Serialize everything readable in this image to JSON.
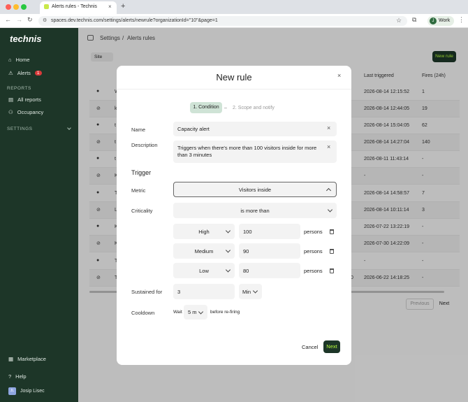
{
  "browser": {
    "tab_title": "Alerts rules - Technis",
    "url": "spaces.dev.technis.com/settings/alerts/newrule?organizationId=\"10\"&page=1",
    "profile_label": "Work",
    "profile_initial": "J"
  },
  "sidebar": {
    "logo": "technis",
    "home": "Home",
    "alerts": "Alerts",
    "alerts_badge": "1",
    "reports_header": "REPORTS",
    "all_reports": "All reports",
    "occupancy": "Occupancy",
    "settings_header": "SETTINGS",
    "marketplace": "Marketplace",
    "help": "Help",
    "user_name": "Josip Lisec",
    "user_initial": "JL"
  },
  "page": {
    "breadcrumb_settings": "Settings",
    "breadcrumb_sep": "/",
    "breadcrumb_current": "Alerts rules",
    "filter_site": "Site",
    "new_rule_button": "New rule",
    "columns": {
      "last_triggered": "Last triggered",
      "fires": "Fires (24h)"
    },
    "rows": [
      {
        "first": "W",
        "last": "2026-08-14 12:15:52",
        "fires": "1"
      },
      {
        "first": "k",
        "last": "2026-08-14 12:44:05",
        "fires": "19"
      },
      {
        "first": "t",
        "last": "2026-08-14 15:04:05",
        "fires": "62"
      },
      {
        "first": "t",
        "last": "2026-08-14 14:27:04",
        "fires": "140"
      },
      {
        "first": "t",
        "last": "2026-08-11 11:43:14",
        "fires": "-"
      },
      {
        "first": "K",
        "last": "-",
        "fires": "-"
      },
      {
        "first": "T",
        "last": "2026-08-14 14:58:57",
        "fires": "7"
      },
      {
        "first": "L",
        "last": "2026-08-14 10:11:14",
        "fires": "3"
      },
      {
        "first": "K",
        "last": "2026-07-22 13:22:19",
        "fires": "-"
      },
      {
        "first": "K",
        "last": "2026-07-30 14:22:09",
        "fires": "-"
      },
      {
        "first": "T",
        "last": "-",
        "fires": "-"
      },
      {
        "first": "T",
        "last": "2026-06-22 14:18:25",
        "fires": "-"
      }
    ],
    "row0_extra": "0",
    "previous": "Previous",
    "next": "Next"
  },
  "modal": {
    "title": "New rule",
    "step1": "1. Condition",
    "step_sep": "–",
    "step2": "2. Scope and notify",
    "name_label": "Name",
    "name_value": "Capacity alert",
    "description_label": "Description",
    "description_value": "Triggers when there's more than 100 visitors inside for more than 3 minutes",
    "trigger_heading": "Trigger",
    "metric_label": "Metric",
    "metric_value": "Visitors inside",
    "criticality_label": "Criticality",
    "operator_value": "is more than",
    "levels": [
      {
        "level": "High",
        "value": "100",
        "unit": "persons"
      },
      {
        "level": "Medium",
        "value": "90",
        "unit": "persons"
      },
      {
        "level": "Low",
        "value": "80",
        "unit": "persons"
      }
    ],
    "sustained_label": "Sustained for",
    "sustained_value": "3",
    "sustained_unit": "Min",
    "cooldown_label": "Cooldown",
    "cooldown_prefix": "Wait",
    "cooldown_value": "5 m",
    "cooldown_suffix": "before re-firing",
    "cancel": "Cancel",
    "next": "Next"
  },
  "colors": {
    "sidebar": "#1d3628",
    "accent": "#b8ff3c",
    "badge": "#d93a3a",
    "step_active": "#cfe3d6"
  }
}
